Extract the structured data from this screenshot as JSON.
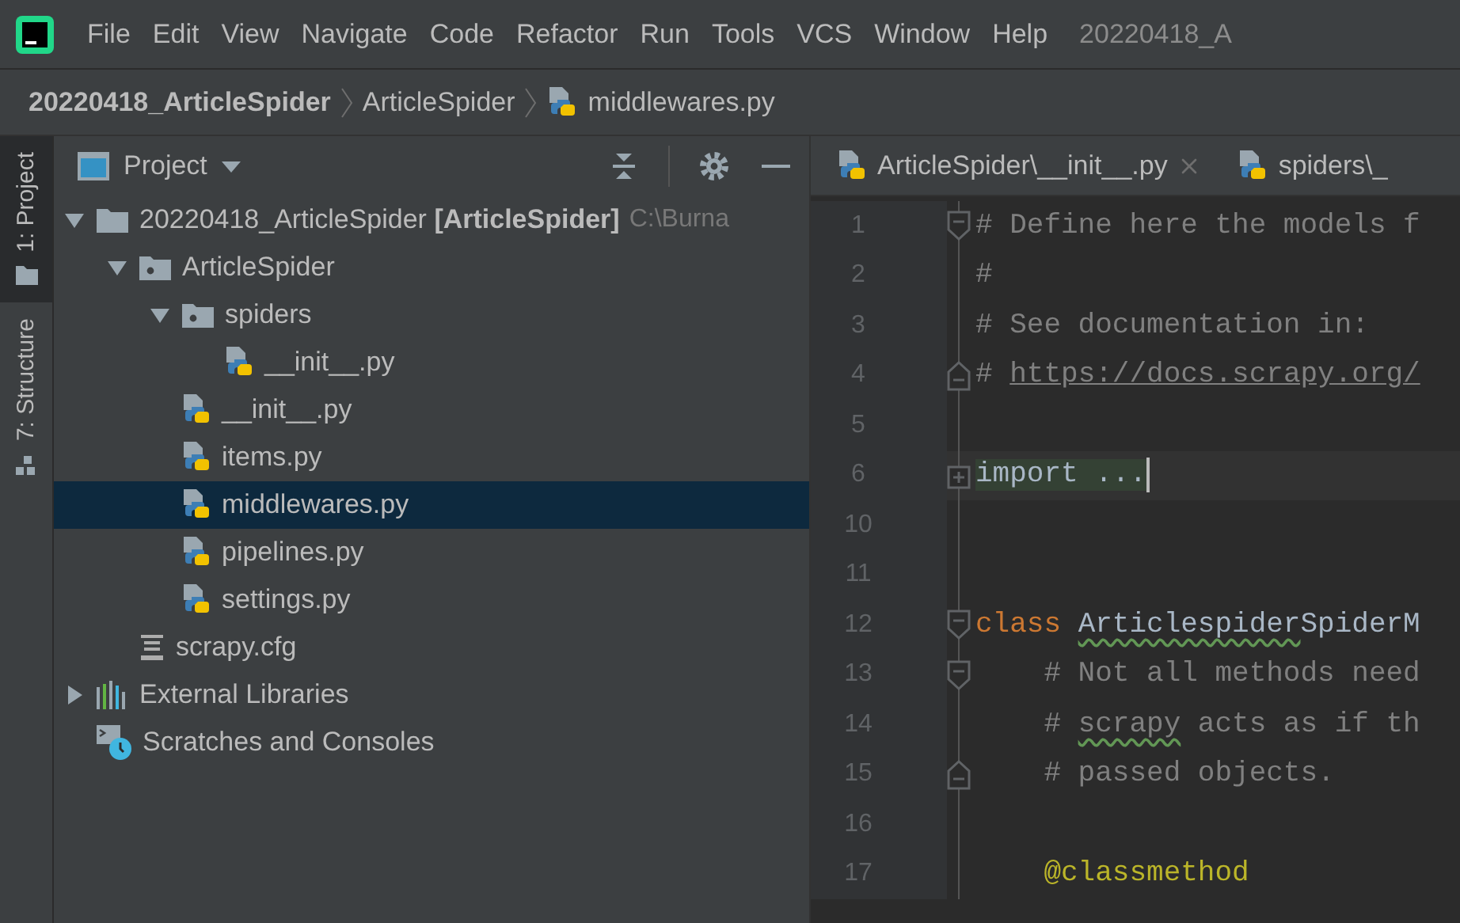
{
  "menu_bar": {
    "items": [
      {
        "label": "File"
      },
      {
        "label": "Edit"
      },
      {
        "label": "View"
      },
      {
        "label": "Navigate"
      },
      {
        "label": "Code"
      },
      {
        "label": "Refactor"
      },
      {
        "label": "Run"
      },
      {
        "label": "Tools"
      },
      {
        "label": "VCS"
      },
      {
        "label": "Window"
      },
      {
        "label": "Help"
      }
    ],
    "window_title": "20220418_A"
  },
  "breadcrumb": [
    {
      "label": "20220418_ArticleSpider",
      "kind": "project"
    },
    {
      "label": "ArticleSpider",
      "kind": "folder"
    },
    {
      "label": "middlewares.py",
      "kind": "file_py"
    }
  ],
  "side_tabs": [
    {
      "label": "1: Project",
      "selected": true,
      "kind": "project"
    },
    {
      "label": "7: Structure",
      "selected": false,
      "kind": "structure"
    }
  ],
  "project_panel": {
    "title": "Project",
    "tree": [
      {
        "label": "20220418_ArticleSpider **[ArticleSpider]**",
        "path": "C:\\Burna",
        "kind": "root",
        "expanded": true,
        "selected": false,
        "children": [
          {
            "label": "ArticleSpider",
            "kind": "package",
            "expanded": true,
            "selected": false,
            "children": [
              {
                "label": "spiders",
                "kind": "package",
                "expanded": true,
                "selected": false,
                "children": [
                  {
                    "label": "__init__.py",
                    "kind": "file_py",
                    "selected": false
                  }
                ]
              },
              {
                "label": "__init__.py",
                "kind": "file_py",
                "selected": false
              },
              {
                "label": "items.py",
                "kind": "file_py",
                "selected": false
              },
              {
                "label": "middlewares.py",
                "kind": "file_py",
                "selected": true
              },
              {
                "label": "pipelines.py",
                "kind": "file_py",
                "selected": false
              },
              {
                "label": "settings.py",
                "kind": "file_py",
                "selected": false
              }
            ]
          },
          {
            "label": "scrapy.cfg",
            "kind": "file_cfg",
            "selected": false
          }
        ]
      },
      {
        "label": "External Libraries",
        "kind": "libraries",
        "expanded": false,
        "selected": false
      },
      {
        "label": "Scratches and Consoles",
        "kind": "scratches",
        "selected": false
      }
    ]
  },
  "editor_tabs": [
    {
      "label": "ArticleSpider\\__init__.py",
      "selected": false,
      "closable": true
    },
    {
      "label": "spiders\\_",
      "selected": false,
      "closable": false
    }
  ],
  "code": [
    {
      "number": "1",
      "fold": {
        "kind": "start"
      },
      "current": false,
      "tokens": [
        {
          "kind": "comment",
          "text": "# Define here the models f",
          "typo": false
        }
      ]
    },
    {
      "number": "2",
      "current": false,
      "tokens": [
        {
          "kind": "comment",
          "text": "#",
          "typo": false
        }
      ]
    },
    {
      "number": "3",
      "current": false,
      "tokens": [
        {
          "kind": "comment",
          "text": "# See documentation in:",
          "typo": false
        }
      ]
    },
    {
      "number": "4",
      "fold": {
        "kind": "end"
      },
      "current": false,
      "tokens": [
        {
          "kind": "comment",
          "text": "# ",
          "typo": false
        },
        {
          "kind": "link",
          "text": "https://docs.scrapy.org/",
          "typo": false
        }
      ]
    },
    {
      "number": "5",
      "current": false
    },
    {
      "number": "6",
      "fold": {
        "kind": "collapsed"
      },
      "current": true,
      "tokens": [
        {
          "kind": "folded",
          "text": "import ...",
          "typo": false
        }
      ]
    },
    {
      "number": "10",
      "current": false
    },
    {
      "number": "11",
      "current": false
    },
    {
      "number": "12",
      "fold": {
        "kind": "start"
      },
      "current": false,
      "tokens": [
        {
          "kind": "keyword",
          "text": "class ",
          "typo": false
        },
        {
          "kind": "name",
          "text": "Articlespider",
          "typo": true
        },
        {
          "kind": "name",
          "text": "SpiderM",
          "typo": false
        }
      ]
    },
    {
      "number": "13",
      "fold": {
        "kind": "start"
      },
      "current": false,
      "tokens": [
        {
          "kind": "comment",
          "text": "    # Not all methods need",
          "typo": false
        }
      ]
    },
    {
      "number": "14",
      "current": false,
      "tokens": [
        {
          "kind": "comment",
          "text": "    # ",
          "typo": false
        },
        {
          "kind": "comment",
          "text": "scrapy",
          "typo": true
        },
        {
          "kind": "comment",
          "text": " acts as if th",
          "typo": false
        }
      ]
    },
    {
      "number": "15",
      "fold": {
        "kind": "end"
      },
      "current": false,
      "tokens": [
        {
          "kind": "comment",
          "text": "    # passed objects.",
          "typo": false
        }
      ]
    },
    {
      "number": "16",
      "current": false
    },
    {
      "number": "17",
      "current": false,
      "tokens": [
        {
          "kind": "decorator",
          "text": "    @classmethod",
          "typo": false
        }
      ]
    }
  ]
}
